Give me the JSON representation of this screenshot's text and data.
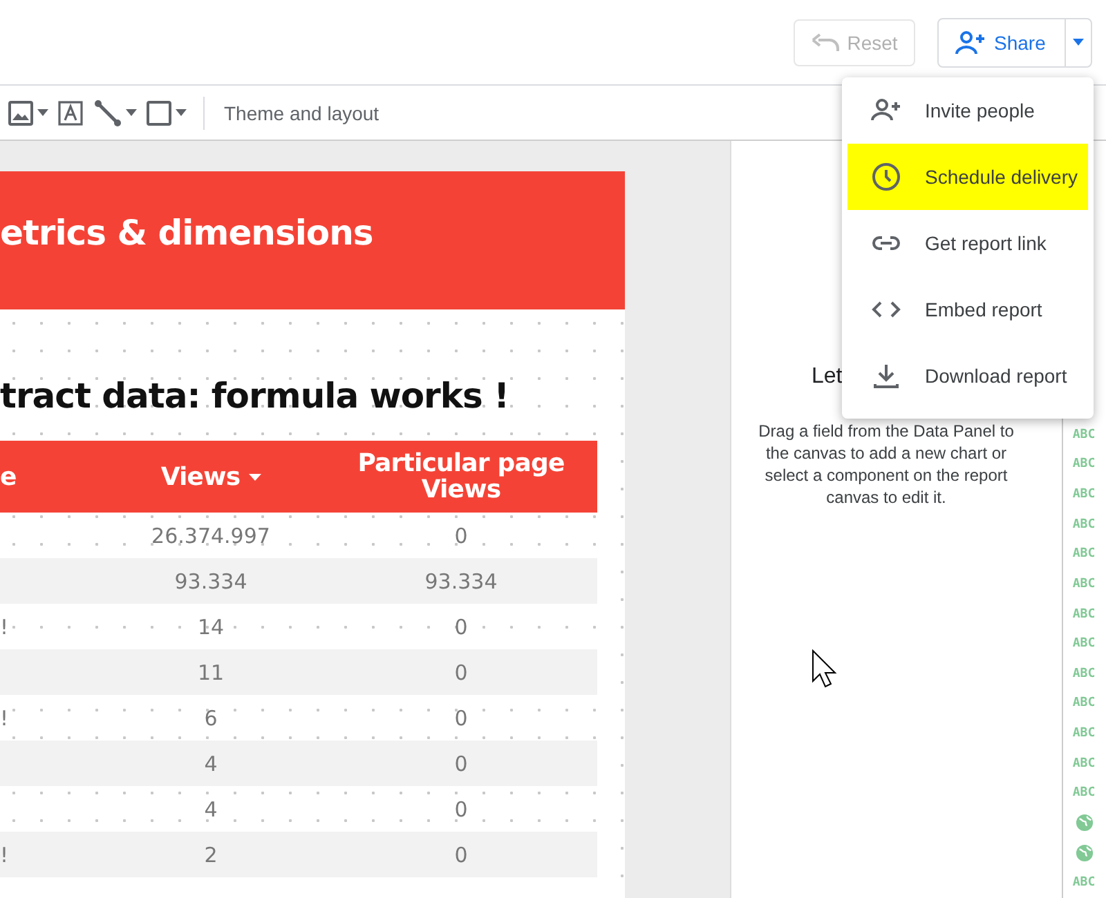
{
  "top_bar": {
    "reset_button": {
      "label": "Reset",
      "disabled": true
    },
    "share_button": {
      "label": "Share"
    }
  },
  "toolbar": {
    "theme_button": "Theme and layout"
  },
  "report": {
    "header": "etrics & dimensions",
    "title": "tract data: formula works !",
    "table": {
      "columns": [
        {
          "label": "e",
          "sorted": false
        },
        {
          "label": "Views",
          "sorted": true
        },
        {
          "label": "Particular page Views",
          "sorted": false
        }
      ],
      "rows": [
        [
          "",
          "26.374.997",
          "0"
        ],
        [
          "",
          "93.334",
          "93.334"
        ],
        [
          "!",
          "14",
          "0"
        ],
        [
          "",
          "11",
          "0"
        ],
        [
          "!",
          "6",
          "0"
        ],
        [
          "",
          "4",
          "0"
        ],
        [
          "",
          "4",
          "0"
        ],
        [
          "!",
          "2",
          "0"
        ]
      ]
    }
  },
  "side_panel": {
    "heading": "Let",
    "text": "Drag a field from the Data Panel to the canvas to add a new chart or select a component on the report canvas to edit it."
  },
  "fields": [
    {
      "kind": "text",
      "label": "ABC"
    },
    {
      "kind": "text",
      "label": "ABC"
    },
    {
      "kind": "text",
      "label": "ABC"
    },
    {
      "kind": "text",
      "label": "ABC"
    },
    {
      "kind": "text",
      "label": "ABC"
    },
    {
      "kind": "text",
      "label": "ABC"
    },
    {
      "kind": "text",
      "label": "ABC"
    },
    {
      "kind": "text",
      "label": "ABC"
    },
    {
      "kind": "text",
      "label": "ABC"
    },
    {
      "kind": "text",
      "label": "ABC"
    },
    {
      "kind": "text",
      "label": "ABC"
    },
    {
      "kind": "text",
      "label": "ABC"
    },
    {
      "kind": "text",
      "label": "ABC"
    },
    {
      "kind": "geo"
    },
    {
      "kind": "geo"
    },
    {
      "kind": "text",
      "label": "ABC"
    }
  ],
  "share_menu": [
    {
      "label": "Invite people",
      "selected": false
    },
    {
      "label": "Schedule delivery",
      "selected": true
    },
    {
      "label": "Get report link",
      "selected": false
    },
    {
      "label": "Embed report",
      "selected": false
    },
    {
      "label": "Download report",
      "selected": false
    }
  ]
}
